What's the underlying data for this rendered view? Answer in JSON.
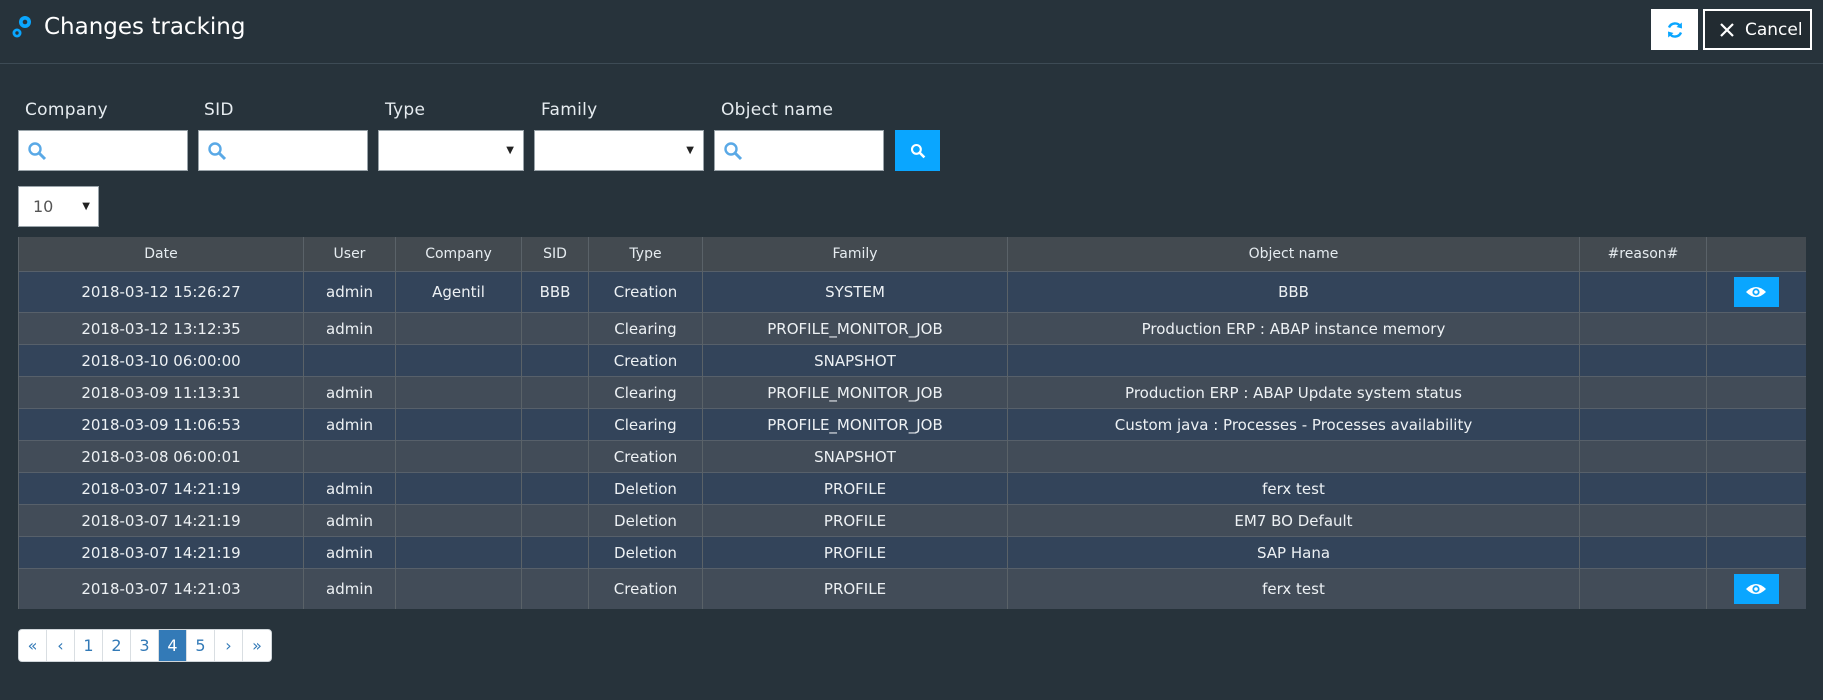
{
  "header": {
    "title": "Changes tracking",
    "cancel_label": "Cancel"
  },
  "filters": {
    "company_label": "Company",
    "sid_label": "SID",
    "type_label": "Type",
    "family_label": "Family",
    "object_name_label": "Object name"
  },
  "page_size": {
    "selected": "10"
  },
  "table": {
    "columns": [
      "Date",
      "User",
      "Company",
      "SID",
      "Type",
      "Family",
      "Object name",
      "#reason#",
      ""
    ],
    "rows": [
      {
        "date": "2018-03-12 15:26:27",
        "user": "admin",
        "company": "Agentil",
        "sid": "BBB",
        "type": "Creation",
        "family": "SYSTEM",
        "object_name": "BBB",
        "reason": ""
      },
      {
        "date": "2018-03-12 13:12:35",
        "user": "admin",
        "company": "",
        "sid": "",
        "type": "Clearing",
        "family": "PROFILE_MONITOR_JOB",
        "object_name": "Production ERP : ABAP instance memory",
        "reason": ""
      },
      {
        "date": "2018-03-10 06:00:00",
        "user": "",
        "company": "",
        "sid": "",
        "type": "Creation",
        "family": "SNAPSHOT",
        "object_name": "",
        "reason": ""
      },
      {
        "date": "2018-03-09 11:13:31",
        "user": "admin",
        "company": "",
        "sid": "",
        "type": "Clearing",
        "family": "PROFILE_MONITOR_JOB",
        "object_name": "Production ERP : ABAP Update system status",
        "reason": ""
      },
      {
        "date": "2018-03-09 11:06:53",
        "user": "admin",
        "company": "",
        "sid": "",
        "type": "Clearing",
        "family": "PROFILE_MONITOR_JOB",
        "object_name": "Custom java : Processes - Processes availability",
        "reason": ""
      },
      {
        "date": "2018-03-08 06:00:01",
        "user": "",
        "company": "",
        "sid": "",
        "type": "Creation",
        "family": "SNAPSHOT",
        "object_name": "",
        "reason": ""
      },
      {
        "date": "2018-03-07 14:21:19",
        "user": "admin",
        "company": "",
        "sid": "",
        "type": "Deletion",
        "family": "PROFILE",
        "object_name": "ferx test",
        "reason": ""
      },
      {
        "date": "2018-03-07 14:21:19",
        "user": "admin",
        "company": "",
        "sid": "",
        "type": "Deletion",
        "family": "PROFILE",
        "object_name": "EM7 BO Default",
        "reason": ""
      },
      {
        "date": "2018-03-07 14:21:19",
        "user": "admin",
        "company": "",
        "sid": "",
        "type": "Deletion",
        "family": "PROFILE",
        "object_name": "SAP Hana",
        "reason": ""
      },
      {
        "date": "2018-03-07 14:21:03",
        "user": "admin",
        "company": "",
        "sid": "",
        "type": "Creation",
        "family": "PROFILE",
        "object_name": "ferx test",
        "reason": ""
      }
    ]
  },
  "pagination": {
    "pages": [
      "«",
      "‹",
      "1",
      "2",
      "3",
      "4",
      "5",
      "›",
      "»"
    ],
    "active": "4"
  },
  "colors": {
    "accent": "#0aa6ff",
    "background": "#27333b",
    "pager_active": "#337ab7"
  },
  "icons": {
    "header": "gears-icon",
    "refresh": "refresh-icon",
    "cancel": "close-icon",
    "search": "magnifier-icon",
    "view": "eye-icon"
  }
}
